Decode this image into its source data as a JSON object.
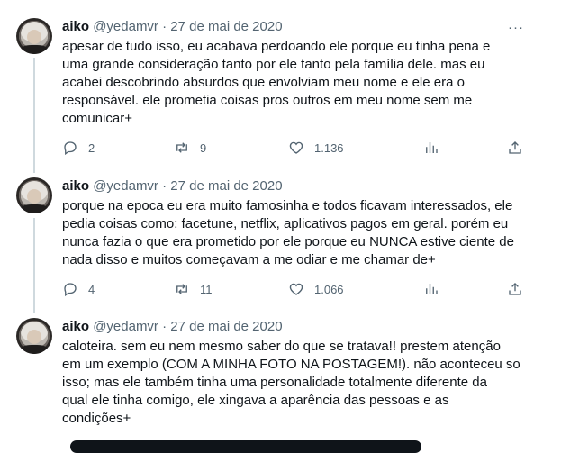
{
  "colors": {
    "text": "#0f1419",
    "muted": "#536471",
    "thread_line": "#cfd9de"
  },
  "tweets": [
    {
      "name": "aiko",
      "handle": "@yedamvr",
      "separator": "·",
      "date": "27 de mai de 2020",
      "text": "apesar de tudo isso, eu acabava perdoando ele porque eu tinha pena e\numa grande consideração tanto por ele tanto pela família dele. mas eu\nacabei descobrindo absurdos que envolviam meu nome e ele era o\nresponsável. ele prometia coisas pros outros em meu nome sem me\ncomunicar+",
      "replies": "2",
      "retweets": "9",
      "likes": "1.136"
    },
    {
      "name": "aiko",
      "handle": "@yedamvr",
      "separator": "·",
      "date": "27 de mai de 2020",
      "text": "porque na epoca eu era muito famosinha e todos ficavam interessados, ele\npedia coisas como: facetune, netflix, aplicativos pagos em geral. porém eu\nnunca fazia o que era prometido por ele porque eu NUNCA estive ciente de\nnada disso e muitos começavam a me odiar e me chamar de+",
      "replies": "4",
      "retweets": "11",
      "likes": "1.066"
    },
    {
      "name": "aiko",
      "handle": "@yedamvr",
      "separator": "·",
      "date": "27 de mai de 2020",
      "text": "caloteira. sem eu nem mesmo saber do que se tratava!! prestem atenção\nem um exemplo (COM A MINHA FOTO NA POSTAGEM!). não aconteceu so\nisso; mas ele também tinha uma personalidade totalmente diferente da\nqual ele tinha comigo, ele xingava a aparência das pessoas e as\ncondições+"
    }
  ],
  "more_label": "···"
}
